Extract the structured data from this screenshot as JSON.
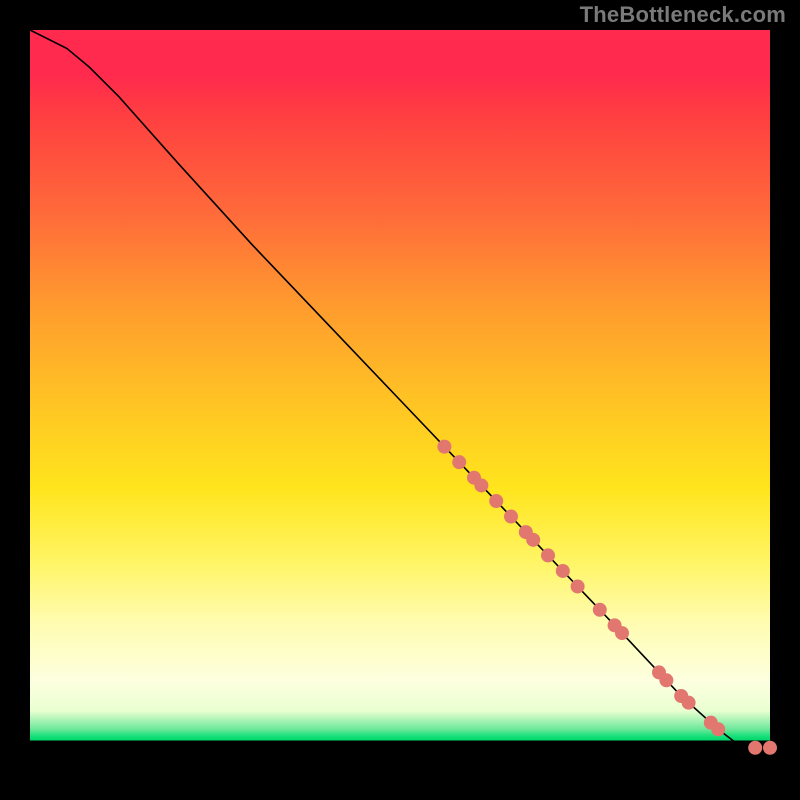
{
  "watermark": "TheBottleneck.com",
  "chart_data": {
    "type": "line",
    "title": "",
    "xlabel": "",
    "ylabel": "",
    "xlim": [
      0,
      100
    ],
    "ylim": [
      0,
      100
    ],
    "curve": {
      "x": [
        0,
        2,
        5,
        8,
        12,
        20,
        30,
        40,
        50,
        60,
        70,
        80,
        88,
        93,
        96,
        98,
        100
      ],
      "y": [
        100,
        99,
        97.5,
        95,
        91,
        82,
        71,
        60.5,
        50,
        39.5,
        29,
        18.5,
        10,
        5.5,
        3.2,
        3,
        3
      ]
    },
    "points_on_curve_x": [
      56,
      58,
      60,
      61,
      63,
      65,
      67,
      68,
      70,
      72,
      74,
      77,
      79,
      80,
      85,
      86,
      88,
      89,
      92,
      93,
      98,
      100
    ],
    "point_radius_px": 7,
    "colors": {
      "curve": "#000000",
      "points": "#e2776f",
      "gradient_top": "#ff2a4d",
      "gradient_mid": "#ffe51d",
      "gradient_green": "#00d66a",
      "background": "#000000"
    }
  }
}
